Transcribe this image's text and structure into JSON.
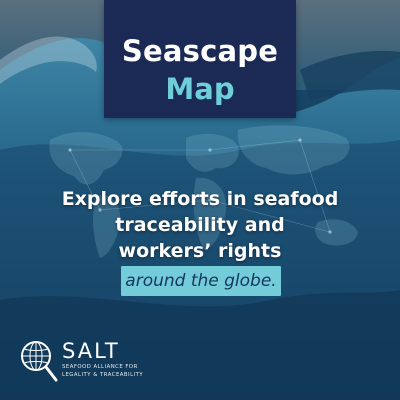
{
  "banner": {
    "title": "Seascape",
    "subtitle": "Map",
    "background_color": "#1b2a55",
    "subtitle_color": "#6fcfd9"
  },
  "headline": {
    "line1": "Explore efforts in seafood",
    "line2": "traceability and",
    "line3": "workers’ rights",
    "highlight": "around the globe."
  },
  "highlight_color": "#74ccd8",
  "logo": {
    "name": "SALT",
    "tagline_line1": "SEAFOOD ALLIANCE FOR",
    "tagline_line2": "LEGALITY & TRACEABILITY",
    "icon": "globe-magnifier-icon"
  },
  "background": "ocean-wave-with-world-map-network"
}
